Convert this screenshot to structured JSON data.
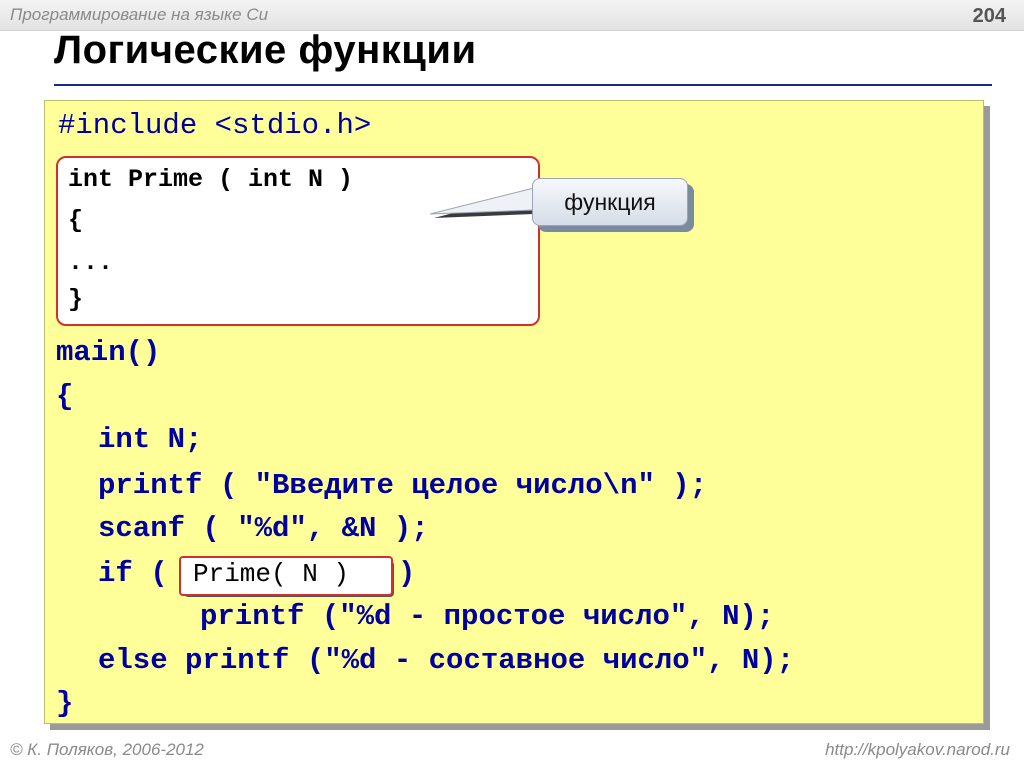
{
  "header": {
    "topic": "Программирование на языке Си",
    "page_number": "204"
  },
  "title": "Логические функции",
  "code": {
    "include": "#include <stdio.h>",
    "function_lines": [
      "int Prime ( int N )",
      "{",
      "...",
      "}"
    ],
    "main": "main()",
    "open_brace": "{",
    "decl": "int N;",
    "printf_prompt": "printf ( \"Введите целое число\\n\" );",
    "scanf": "scanf ( \"%d\", &N );",
    "if_prefix": "if (",
    "if_call": "Prime( N )",
    "if_suffix": ")",
    "printf_prime": "printf (\"%d - простое число\", N);",
    "else_line": "else printf (\"%d - составное число\", N);",
    "close_brace": "}"
  },
  "callout": {
    "label": "функция"
  },
  "footer": {
    "author": "© К. Поляков, 2006-2012",
    "url": "http://kpolyakov.narod.ru"
  },
  "colors": {
    "code_bg": "#ffff99",
    "code_text": "#0000a0",
    "highlight_border": "#d03030"
  }
}
